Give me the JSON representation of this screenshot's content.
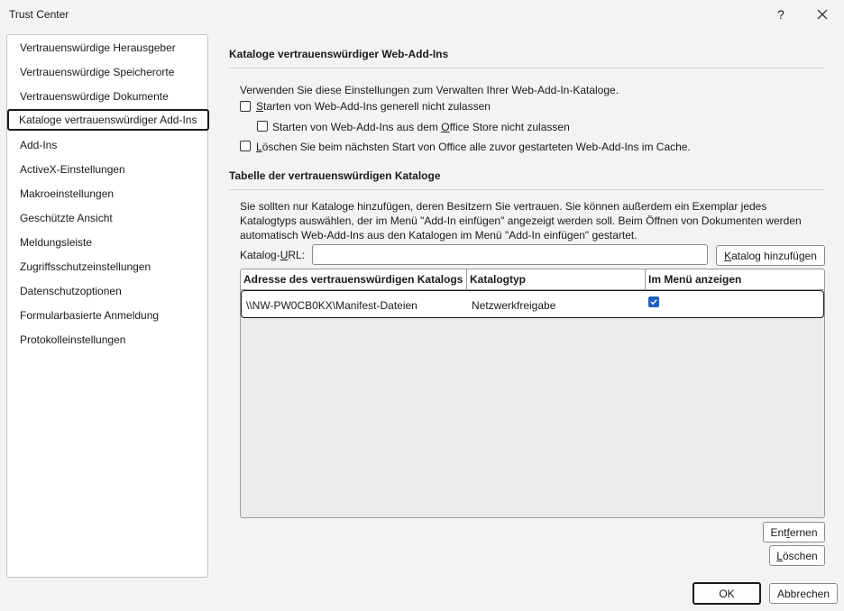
{
  "window": {
    "title": "Trust Center",
    "help_label": "?"
  },
  "sidebar": {
    "items": [
      {
        "label": "Vertrauenswürdige Herausgeber"
      },
      {
        "label": "Vertrauenswürdige Speicherorte"
      },
      {
        "label": "Vertrauenswürdige Dokumente"
      },
      {
        "label": "Kataloge vertrauenswürdiger Add-Ins",
        "selected": true
      },
      {
        "label": "Add-Ins"
      },
      {
        "label": "ActiveX-Einstellungen"
      },
      {
        "label": "Makroeinstellungen"
      },
      {
        "label": "Geschützte Ansicht"
      },
      {
        "label": "Meldungsleiste"
      },
      {
        "label": "Zugriffsschutzeinstellungen"
      },
      {
        "label": "Datenschutzoptionen"
      },
      {
        "label": "Formularbasierte Anmeldung"
      },
      {
        "label": "Protokolleinstellungen"
      }
    ]
  },
  "section1": {
    "heading": "Kataloge vertrauenswürdiger Web-Add-Ins",
    "intro": "Verwenden Sie diese Einstellungen zum Verwalten Ihrer Web-Add-In-Kataloge.",
    "cb1": {
      "u": "S",
      "rest": "tarten von Web-Add-Ins generell nicht zulassen",
      "checked": false
    },
    "cb2": {
      "pre": "Starten von Web-Add-Ins aus dem ",
      "u": "O",
      "rest": "ffice Store nicht zulassen",
      "checked": false
    },
    "cb3": {
      "u": "L",
      "rest": "öschen Sie beim nächsten Start von Office alle zuvor gestarteten Web-Add-Ins im Cache.",
      "checked": false
    }
  },
  "section2": {
    "heading": "Tabelle der vertrauenswürdigen Kataloge",
    "paragraph": "Sie sollten nur Kataloge hinzufügen, deren Besitzern Sie vertrauen. Sie können außerdem ein Exemplar jedes Katalogtyps auswählen, der im Menü \"Add-In einfügen\" angezeigt werden soll. Beim Öffnen von Dokumenten werden automatisch Web-Add-Ins aus den Katalogen im Menü \"Add-In einfügen\" gestartet.",
    "url_label_pre": "Katalog-",
    "url_label_u": "U",
    "url_label_post": "RL:",
    "url_value": "",
    "add_button": {
      "pre": "",
      "u": "K",
      "post": "atalog hinzufügen"
    },
    "table": {
      "columns": [
        "Adresse des vertrauenswürdigen Katalogs",
        "Katalogtyp",
        "Im Menü anzeigen"
      ],
      "rows": [
        {
          "address": "\\\\NW-PW0CB0KX\\Manifest-Dateien",
          "type": "Netzwerkfreigabe",
          "show_in_menu": true
        }
      ]
    },
    "remove_button": {
      "pre": "Ent",
      "u": "f",
      "post": "ernen"
    },
    "clear_button": {
      "pre": "",
      "u": "L",
      "post": "öschen"
    }
  },
  "footer": {
    "ok_label": "OK",
    "cancel_label": "Abbrechen"
  },
  "colors": {
    "accent": "#1f5fbf",
    "background": "#f3f3f3"
  }
}
